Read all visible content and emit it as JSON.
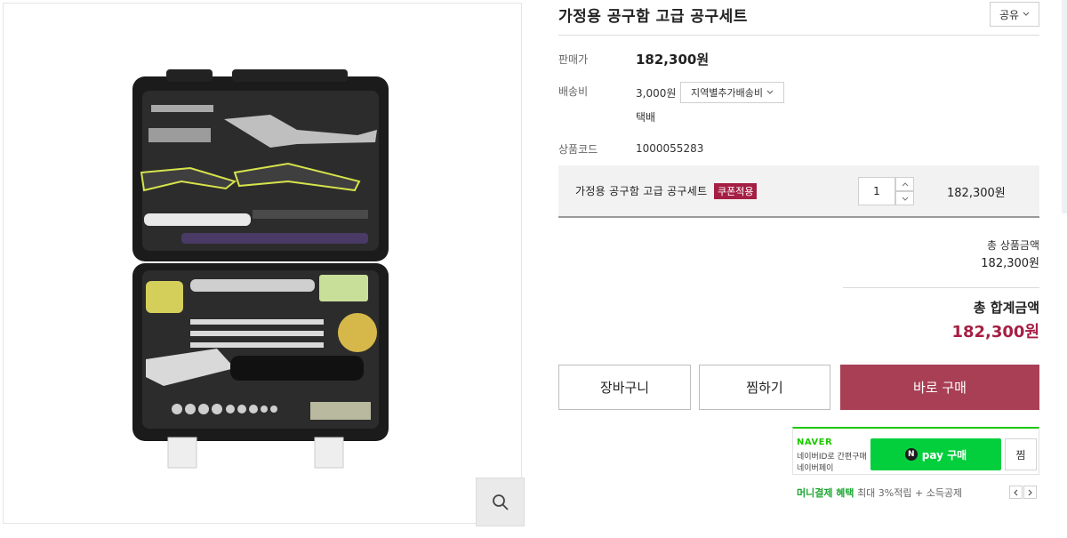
{
  "product": {
    "title": "가정용 공구함 고급 공구세트",
    "share_label": "공유",
    "sale_price_label": "판매가",
    "sale_price": "182,300원",
    "shipping_label": "배송비",
    "shipping_fee": "3,000원",
    "shipping_option": "지역별추가배송비",
    "shipping_method": "택배",
    "code_label": "상품코드",
    "code": "1000055283"
  },
  "option": {
    "name": "가정용 공구함 고급 공구세트",
    "coupon_badge": "쿠폰적용",
    "quantity": "1",
    "price": "182,300원"
  },
  "totals": {
    "subtotal_label": "총 상품금액",
    "subtotal_value": "182,300원",
    "total_label": "총 합계금액",
    "total_value": "182,300원"
  },
  "actions": {
    "cart": "장바구니",
    "wish": "찜하기",
    "buy": "바로 구매"
  },
  "npay": {
    "brand": "NAVER",
    "desc_line1": "네이버ID로 간편구매",
    "desc_line2": "네이버페이",
    "n_mark": "N",
    "button_label": "pay 구매",
    "wish_label": "찜",
    "benefit_strong": "머니결제 혜택",
    "benefit_text": "최대 3%적립 + 소득공제"
  },
  "colors": {
    "accent": "#a83f55",
    "coupon": "#a51f44",
    "naver_green": "#03cf3d"
  },
  "icons": {
    "zoom": "magnifier-icon",
    "dropdown": "chevron-down-icon"
  }
}
